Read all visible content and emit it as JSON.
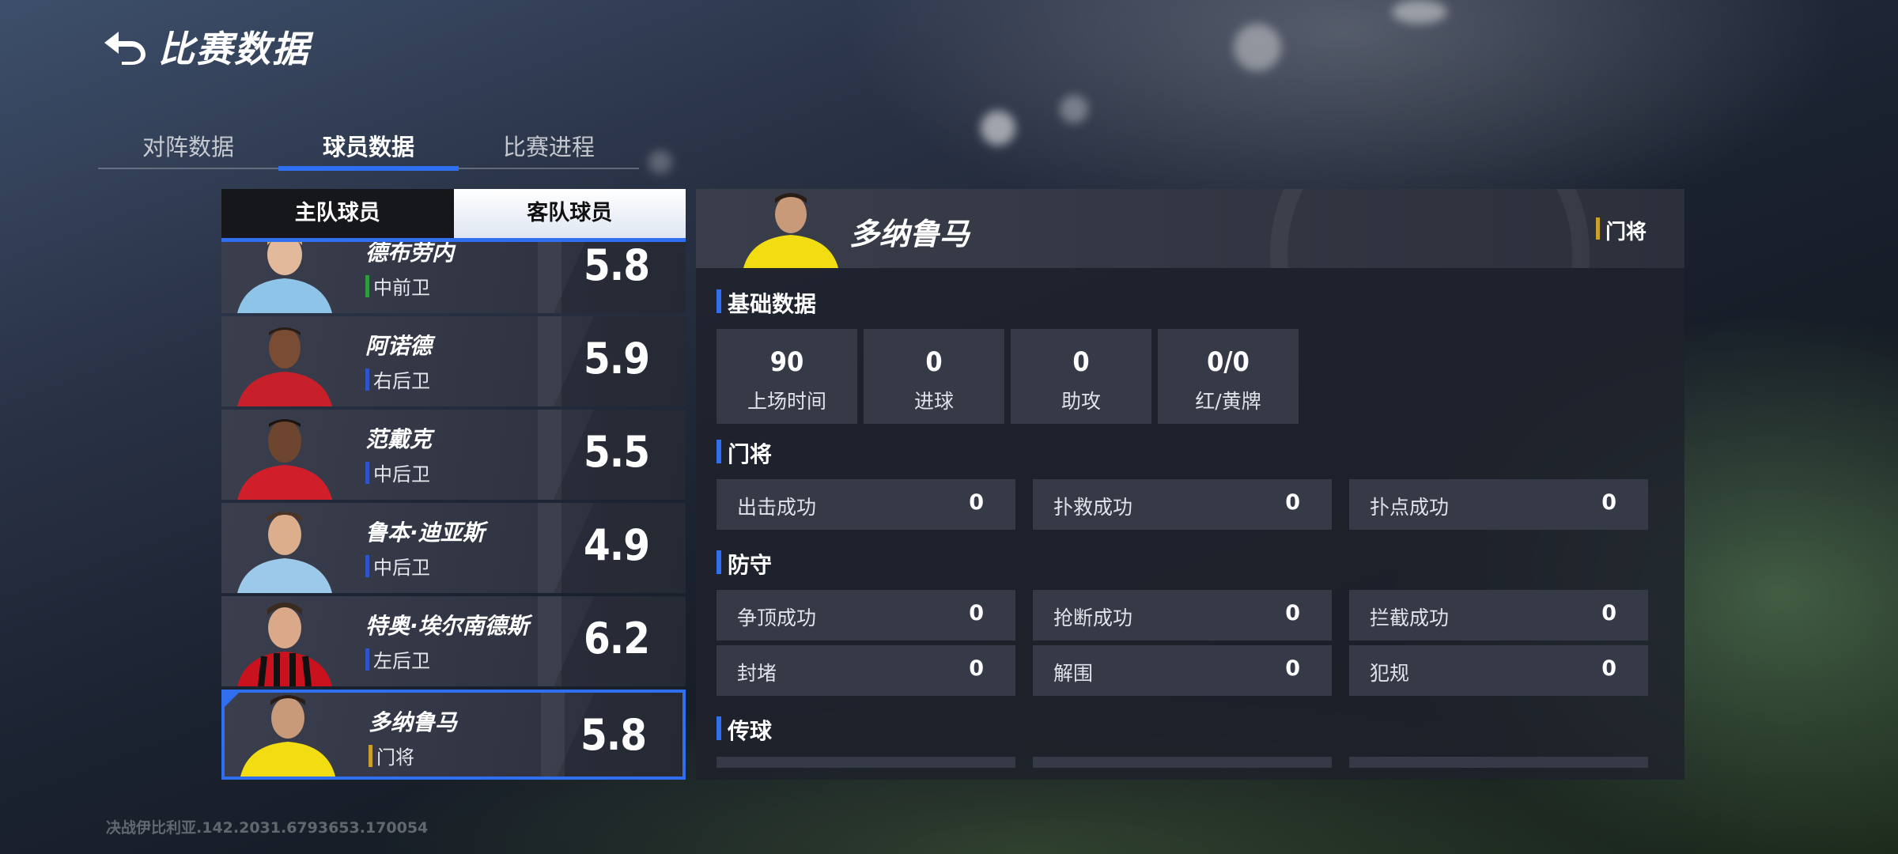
{
  "header": {
    "title": "比赛数据"
  },
  "tabs": [
    {
      "label": "对阵数据",
      "active": false
    },
    {
      "label": "球员数据",
      "active": true
    },
    {
      "label": "比赛进程",
      "active": false
    }
  ],
  "team_toggle": {
    "home": "主队球员",
    "away": "客队球员",
    "selected": "home"
  },
  "players": [
    {
      "name": "德布劳内",
      "position": "中前卫",
      "rating": "5.8",
      "pos_color": "#2f9a3e",
      "jersey": "#8ec4e8"
    },
    {
      "name": "阿诺德",
      "position": "右后卫",
      "rating": "5.9",
      "pos_color": "#2f55c8",
      "jersey": "#c8202a"
    },
    {
      "name": "范戴克",
      "position": "中后卫",
      "rating": "5.5",
      "pos_color": "#2f55c8",
      "jersey": "#d01f2a"
    },
    {
      "name": "鲁本·迪亚斯",
      "position": "中后卫",
      "rating": "4.9",
      "pos_color": "#2f55c8",
      "jersey": "#9cc8ea"
    },
    {
      "name": "特奥·埃尔南德斯",
      "position": "左后卫",
      "rating": "6.2",
      "pos_color": "#2f55c8",
      "jersey": "#c9121e"
    },
    {
      "name": "多纳鲁马",
      "position": "门将",
      "rating": "5.8",
      "pos_color": "#c9a12a",
      "jersey": "#f2dc12",
      "selected": true
    }
  ],
  "detail": {
    "name": "多纳鲁马",
    "position": "门将",
    "sections": {
      "basic": "基础数据",
      "goalkeeper": "门将",
      "defense": "防守",
      "passing": "传球"
    },
    "basic_stats": [
      {
        "value": "90",
        "label": "上场时间"
      },
      {
        "value": "0",
        "label": "进球"
      },
      {
        "value": "0",
        "label": "助攻"
      },
      {
        "value": "0/0",
        "label": "红/黄牌"
      }
    ],
    "goalkeeper_stats": [
      {
        "label": "出击成功",
        "value": "0"
      },
      {
        "label": "扑救成功",
        "value": "0"
      },
      {
        "label": "扑点成功",
        "value": "0"
      }
    ],
    "defense_stats": [
      {
        "label": "争顶成功",
        "value": "0"
      },
      {
        "label": "抢断成功",
        "value": "0"
      },
      {
        "label": "拦截成功",
        "value": "0"
      },
      {
        "label": "封堵",
        "value": "0"
      },
      {
        "label": "解围",
        "value": "0"
      },
      {
        "label": "犯规",
        "value": "0"
      }
    ]
  },
  "watermark": "决战伊比利亚.142.2031.6793653.170054",
  "colors": {
    "accent": "#2f6ff0",
    "gk": "#c9a12a",
    "panel": "#363a47"
  }
}
